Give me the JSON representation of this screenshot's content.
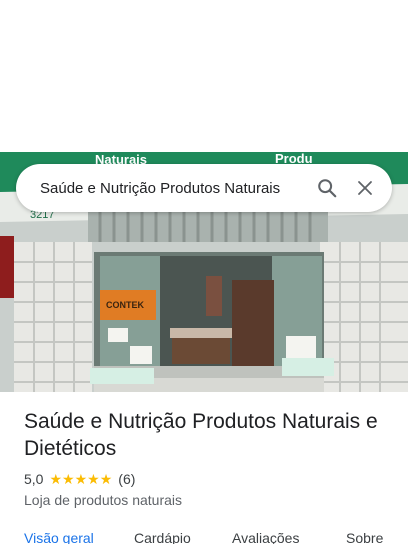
{
  "search": {
    "query": "Saúde e Nutrição Produtos Naturais"
  },
  "hero": {
    "sign_top": "Naturais",
    "sign_right": "Produ",
    "sign_phone": "3217",
    "poster_brand": "CONTEK"
  },
  "place": {
    "name": "Saúde e Nutrição Produtos Naturais e Dietéticos",
    "rating": "5,0",
    "rating_value": 5,
    "review_count": "(6)",
    "category": "Loja de produtos naturais"
  },
  "tabs": [
    {
      "label": "Visão geral",
      "active": true
    },
    {
      "label": "Cardápio",
      "active": false
    },
    {
      "label": "Avaliações",
      "active": false
    },
    {
      "label": "Sobre",
      "active": false
    }
  ],
  "colors": {
    "accent": "#1a73e8",
    "star": "#fbbc04",
    "sign_green": "#1f8a5b"
  }
}
